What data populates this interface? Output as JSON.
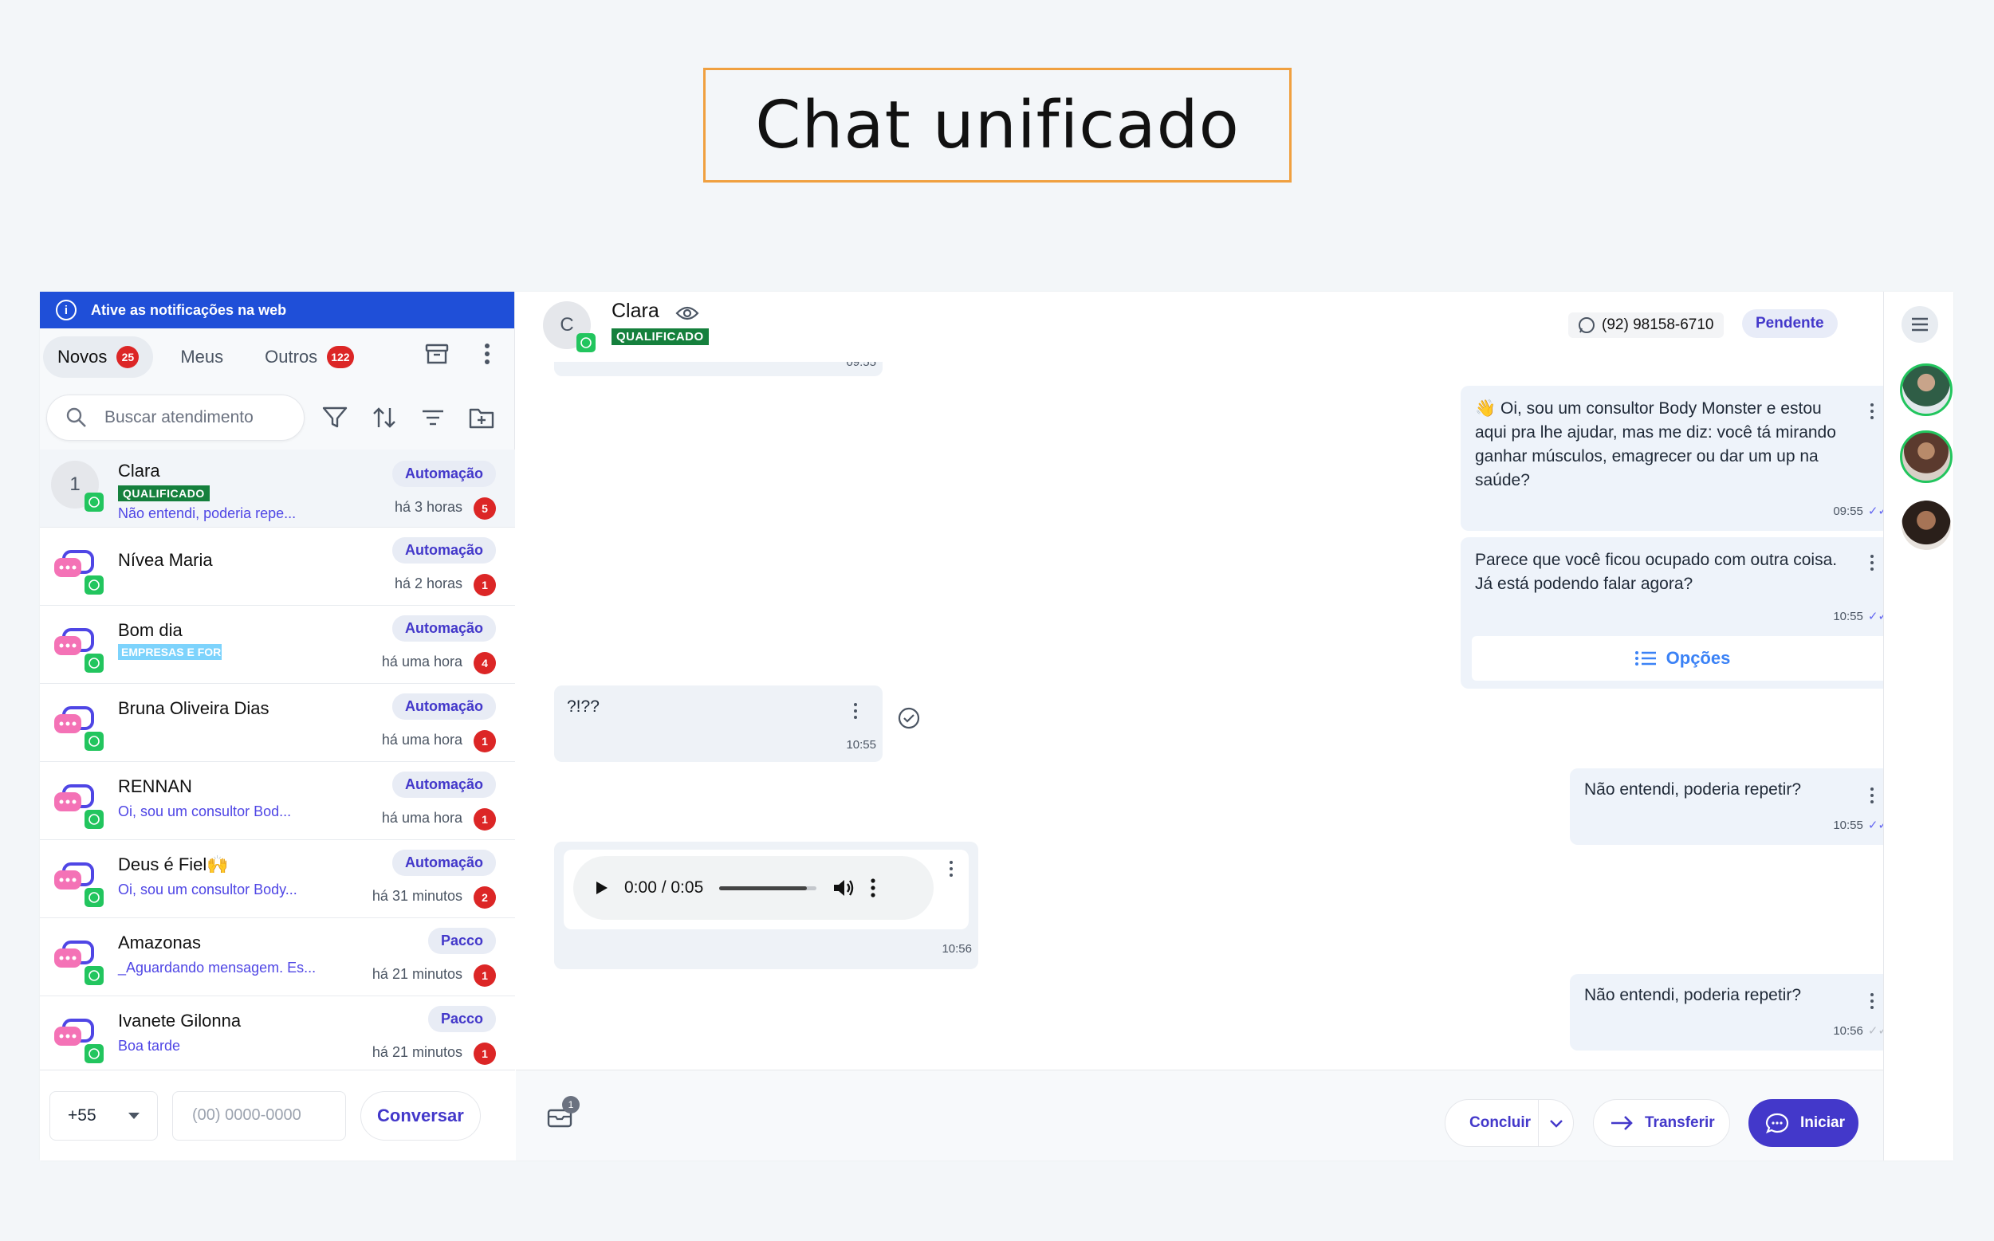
{
  "page_title": "Chat unificado",
  "notify_banner": "Ative as notificações na web",
  "tabs": [
    {
      "label": "Novos",
      "count": "25"
    },
    {
      "label": "Meus",
      "count": ""
    },
    {
      "label": "Outros",
      "count": "122"
    }
  ],
  "search": {
    "placeholder": "Buscar atendimento"
  },
  "conversations": [
    {
      "name": "Clara",
      "tag": "QUALIFICADO",
      "preview": "Não entendi, poderia repe...",
      "pill": "Automação",
      "time": "há 3 horas",
      "count": "5",
      "avatar_label": "1"
    },
    {
      "name": "Nívea Maria",
      "tag": "",
      "preview": "",
      "pill": "Automação",
      "time": "há 2 horas",
      "count": "1"
    },
    {
      "name": "Bom dia",
      "tag": "EMPRESAS E FOR",
      "preview": "",
      "pill": "Automação",
      "time": "há uma hora",
      "count": "4"
    },
    {
      "name": "Bruna Oliveira Dias",
      "tag": "",
      "preview": "",
      "pill": "Automação",
      "time": "há uma hora",
      "count": "1"
    },
    {
      "name": "RENNAN",
      "tag": "",
      "preview": "Oi, sou um consultor Bod...",
      "pill": "Automação",
      "time": "há uma hora",
      "count": "1"
    },
    {
      "name": "Deus é Fiel🙌",
      "tag": "",
      "preview": "Oi, sou um consultor Body...",
      "pill": "Automação",
      "time": "há 31 minutos",
      "count": "2"
    },
    {
      "name": "Amazonas",
      "tag": "",
      "preview": "_Aguardando mensagem. Es...",
      "pill": "Pacco",
      "time": "há 21 minutos",
      "count": "1"
    },
    {
      "name": "Ivanete Gilonna",
      "tag": "",
      "preview": "Boa tarde",
      "pill": "Pacco",
      "time": "há 21 minutos",
      "count": "1"
    }
  ],
  "new_chat": {
    "country_code": "+55",
    "phone_placeholder": "(00) 0000-0000",
    "button": "Conversar"
  },
  "chat_header": {
    "avatar_letter": "C",
    "name": "Clara",
    "tag": "QUALIFICADO",
    "phone": "(92) 98158-6710",
    "status": "Pendente"
  },
  "messages": {
    "top_time": "09:55",
    "m1": {
      "text": "👋 Oi, sou um consultor Body Monster e estou aqui pra lhe ajudar, mas me diz: você tá mirando ganhar músculos, emagrecer ou dar um up na saúde?",
      "time": "09:55"
    },
    "m2": {
      "text": "Parece que você ficou ocupado com outra coisa. Já está podendo falar agora?",
      "time": "10:55",
      "options_label": "Opções"
    },
    "m3": {
      "text": "?!??",
      "time": "10:55"
    },
    "m4": {
      "text": "Não entendi, poderia repetir?",
      "time": "10:55"
    },
    "m5": {
      "audio_time": "0:00 / 0:05",
      "time": "10:56"
    },
    "m6": {
      "text": "Não entendi, poderia repetir?",
      "time": "10:56"
    }
  },
  "footer": {
    "attach_count": "1",
    "conclude": "Concluir",
    "transfer": "Transferir",
    "start": "Iniciar"
  },
  "colors": {
    "primary": "#4338ca",
    "banner": "#1f4fd8",
    "badge": "#dc2626",
    "qualified": "#15803d",
    "whatsapp": "#22c55e"
  }
}
